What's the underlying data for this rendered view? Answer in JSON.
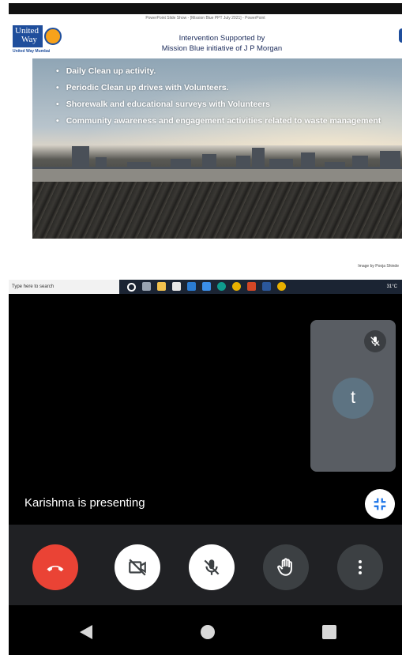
{
  "presentation": {
    "window_title": "PowerPoint Slide Show - [Mission Blue PPT July 2021] - PowerPoint",
    "logo_text_line1": "United",
    "logo_text_line2": "Way",
    "logo_subtitle": "United Way Mumbai",
    "heading_line1": "Intervention Supported by",
    "heading_line2": "Mission Blue initiative of J P Morgan",
    "bullets": [
      "Daily Clean up  activity.",
      "Periodic Clean up drives with Volunteers.",
      "Shorewalk and educational surveys with Volunteers",
      "Community awareness and engagement activities related to waste management"
    ],
    "image_credit": "Image by Pooja Shinde"
  },
  "taskbar": {
    "search_placeholder": "Type here to search",
    "temperature": "31°C"
  },
  "call": {
    "participant_initial": "t",
    "presenting_text": "Karishma is presenting"
  },
  "colors": {
    "end_call": "#ea4335",
    "control_dark": "#3c4043",
    "control_light": "#ffffff"
  }
}
